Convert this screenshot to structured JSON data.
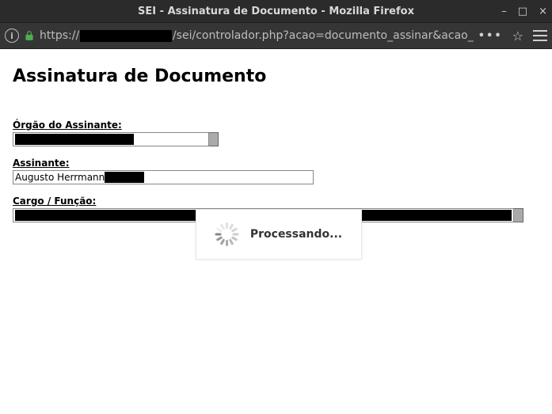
{
  "window": {
    "title": "SEI - Assinatura de Documento - Mozilla Firefox",
    "minimize": "–",
    "maximize": "□",
    "close": "×"
  },
  "navbar": {
    "url_prefix": "https://",
    "url_suffix": "/sei/controlador.php?acao=documento_assinar&acao_",
    "dots": "•••"
  },
  "page": {
    "title": "Assinatura de Documento",
    "orgao_label": "Órgão do Assinante:",
    "assinante_label": "Assinante:",
    "assinante_value": "Augusto Herrmann ",
    "cargo_label": "Cargo / Função:"
  },
  "overlay": {
    "text": "Processando..."
  }
}
